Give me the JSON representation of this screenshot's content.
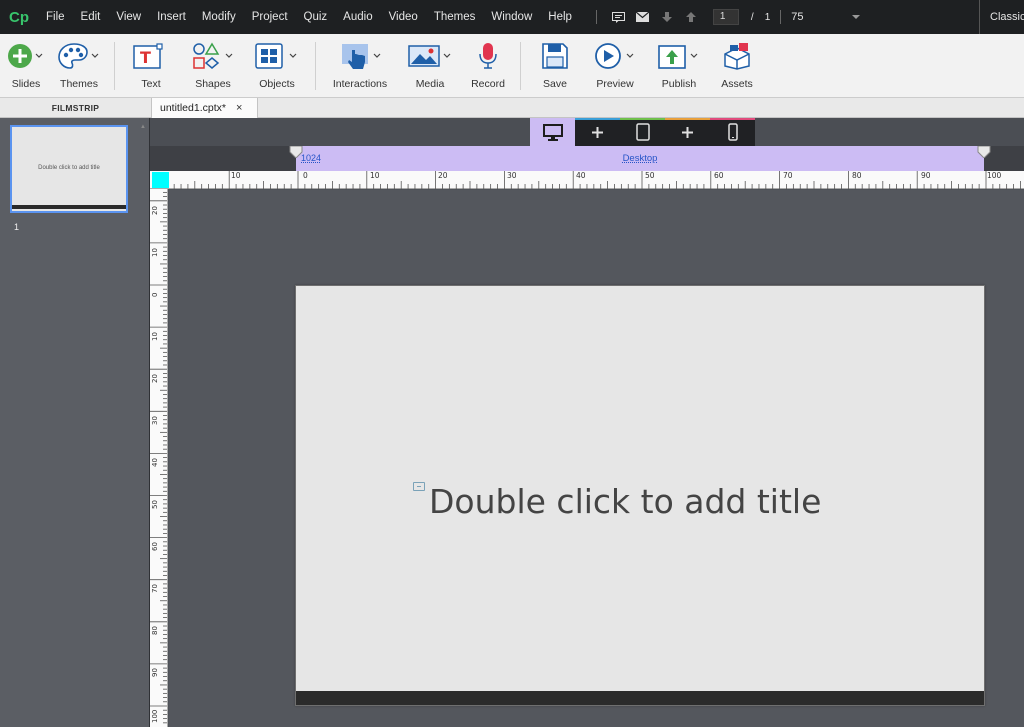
{
  "menubar": {
    "logo": "Cp",
    "items": [
      "File",
      "Edit",
      "View",
      "Insert",
      "Modify",
      "Project",
      "Quiz",
      "Audio",
      "Video",
      "Themes",
      "Window",
      "Help"
    ],
    "slide_number": "1",
    "slide_separator": "/",
    "slide_total": "1",
    "zoom": "75",
    "workspace": "Classic"
  },
  "toolbar": {
    "slides": "Slides",
    "themes": "Themes",
    "text": "Text",
    "shapes": "Shapes",
    "objects": "Objects",
    "interactions": "Interactions",
    "media": "Media",
    "record": "Record",
    "save": "Save",
    "preview": "Preview",
    "publish": "Publish",
    "assets": "Assets"
  },
  "tabs": {
    "filmstrip": "FILMSTRIP",
    "document": "untitled1.cptx*",
    "close": "×"
  },
  "filmstrip": {
    "thumb_title": "Double click to add title",
    "slide_number": "1"
  },
  "breakpoints": {
    "width": "1024",
    "name": "Desktop",
    "colors": {
      "desktop": "#ccbcf3",
      "tablet": "#e9a03b",
      "mobile": "#e14b7d",
      "stripe_blue": "#3a9fd8",
      "stripe_green": "#6fc04b"
    }
  },
  "ruler": {
    "h_labels": [
      "10",
      "10",
      "20",
      "30",
      "40",
      "50",
      "60",
      "70",
      "80",
      "90",
      "100"
    ],
    "h_zero": "0",
    "v_labels": [
      "20",
      "10",
      "0",
      "10",
      "20",
      "30",
      "40",
      "50",
      "60",
      "70",
      "80",
      "90",
      "100"
    ]
  },
  "slide": {
    "title_placeholder": "Double click to add title"
  }
}
